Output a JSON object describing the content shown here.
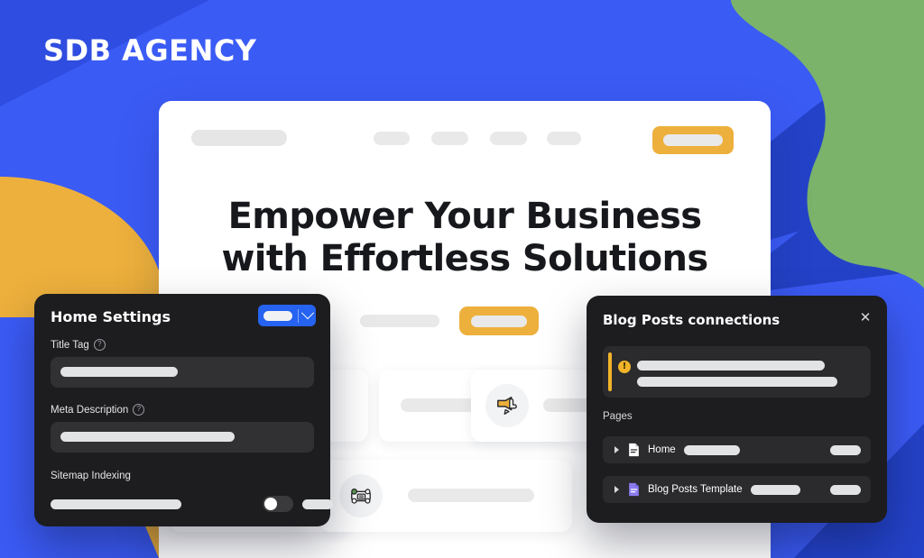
{
  "brand": {
    "name": "SDB AGENCY",
    "logo_color": "#FFFFFF"
  },
  "colors": {
    "background_blue": "#3B5BF5",
    "deep_blue": "#2442C8",
    "green": "#7BB36B",
    "orange": "#EDB03C",
    "light_blue": "#7BC6EC",
    "panel_dark": "#1D1D1F",
    "accent_blue": "#2563F0",
    "warning_amber": "#F0B429",
    "template_purple": "#8B7BF0"
  },
  "website_mockup": {
    "nav": {
      "logo_placeholder": "",
      "links": [
        "",
        "",
        "",
        ""
      ],
      "cta_button_label": ""
    },
    "hero": {
      "headline_line1": "Empower Your Business",
      "headline_line2": "with Effortless Solutions",
      "subtext_placeholder": "",
      "cta_button_label": ""
    },
    "cards": [
      {
        "icon": "",
        "text_placeholder": ""
      },
      {
        "icon": "megaphone-icon",
        "text_placeholder": ""
      },
      {
        "icon": "",
        "text_placeholder": ""
      },
      {
        "icon": "robot-chat-icon",
        "text_placeholder": ""
      }
    ]
  },
  "home_settings_panel": {
    "title": "Home Settings",
    "publish_button_label": "",
    "publish_dropdown_icon": "chevron-down-icon",
    "fields": [
      {
        "label": "Title Tag",
        "help_icon": "question-mark-icon",
        "value": ""
      },
      {
        "label": "Meta Description",
        "help_icon": "question-mark-icon",
        "value": ""
      }
    ],
    "sitemap": {
      "label": "Sitemap Indexing",
      "toggle_state": "off",
      "value": ""
    }
  },
  "blog_posts_panel": {
    "title": "Blog Posts connections",
    "close_icon": "close-icon",
    "alert": {
      "icon": "warning-icon",
      "line1": "",
      "line2": ""
    },
    "section_label": "Pages",
    "rows": [
      {
        "expand_icon": "caret-right-icon",
        "doc_icon": "page-icon",
        "label": "Home",
        "meta_placeholder": "",
        "action_placeholder": "",
        "icon_color": "#FFFFFF"
      },
      {
        "expand_icon": "caret-right-icon",
        "doc_icon": "template-icon",
        "label": "Blog Posts Template",
        "meta_placeholder": "",
        "action_placeholder": "",
        "icon_color": "#8B7BF0"
      }
    ]
  }
}
